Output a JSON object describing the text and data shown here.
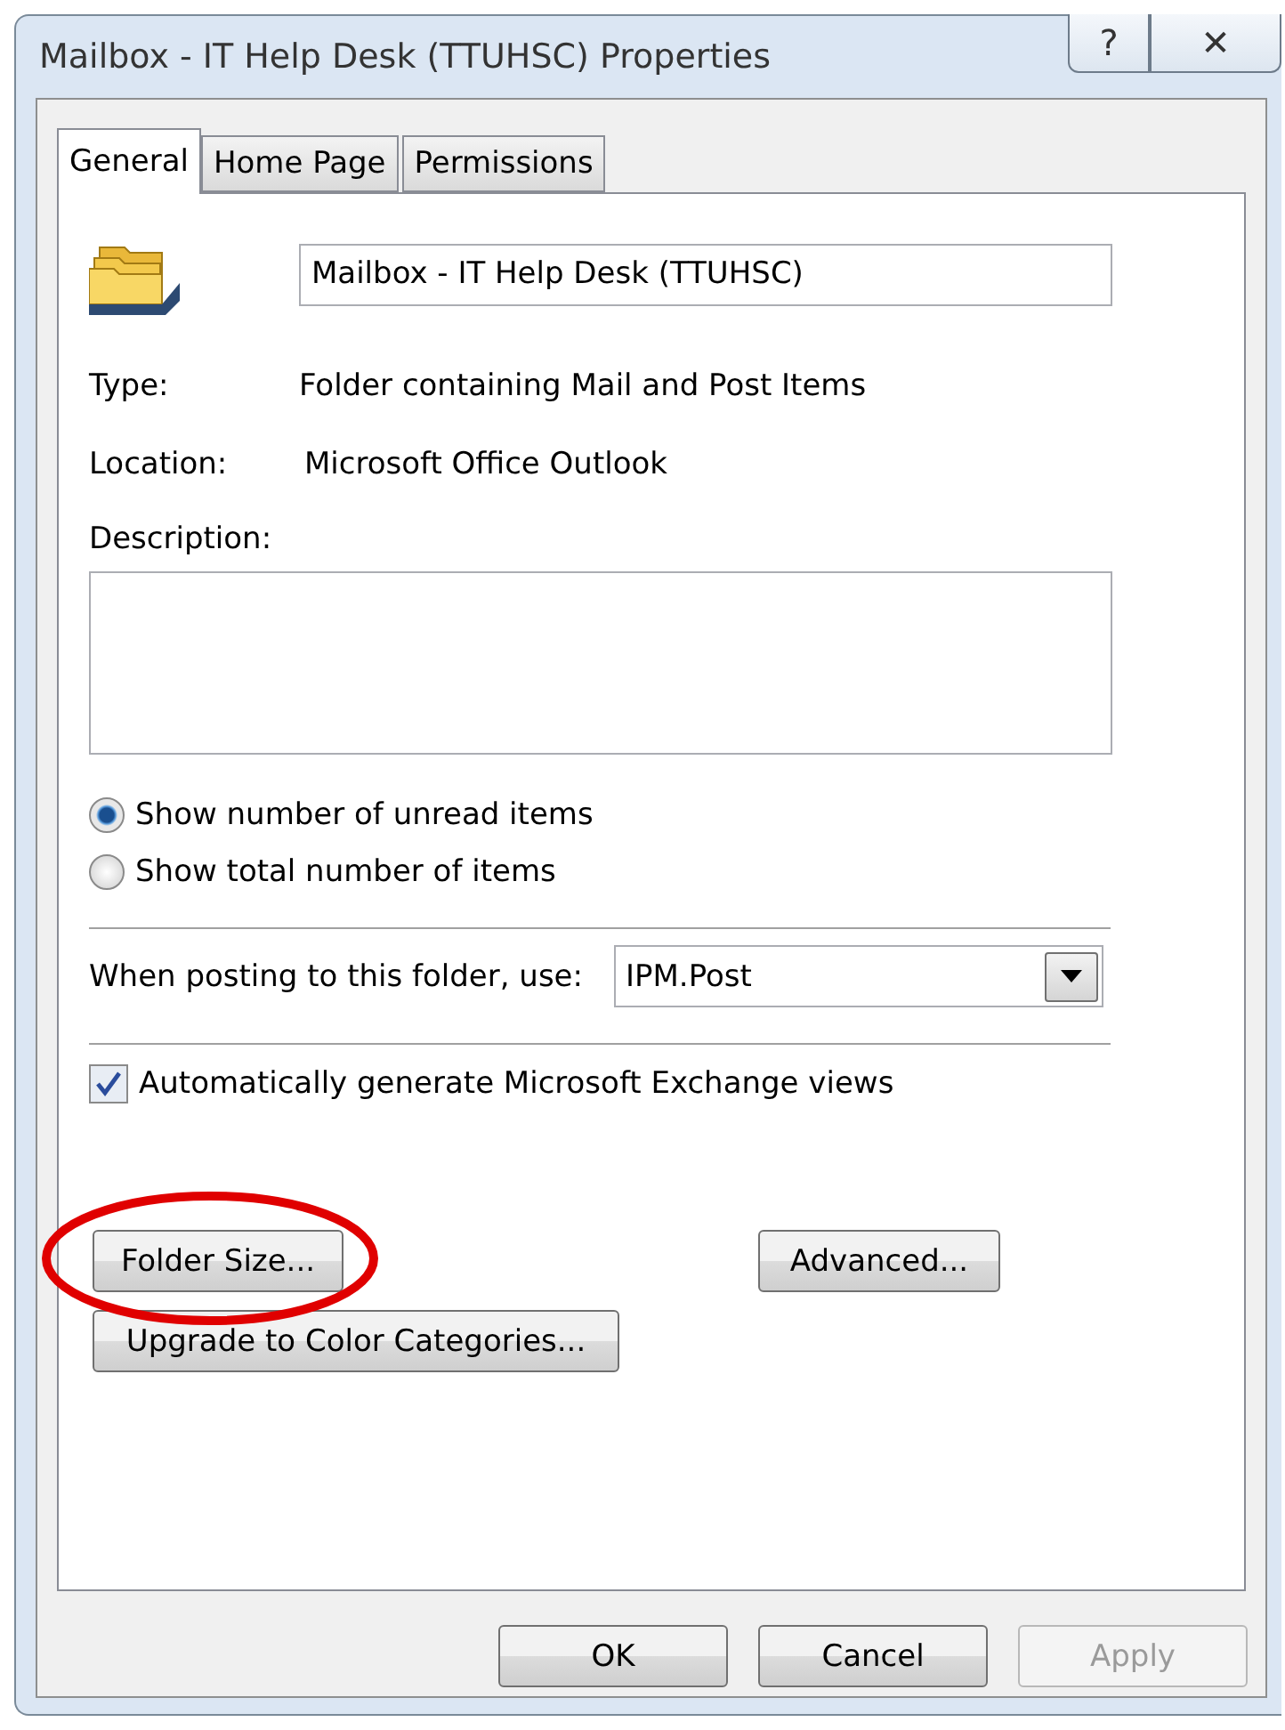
{
  "window": {
    "title": "Mailbox - IT Help Desk (TTUHSC) Properties",
    "title_buttons": [
      "?",
      "✕"
    ]
  },
  "tabs": [
    {
      "label": "General",
      "selected": true
    },
    {
      "label": "Home Page",
      "selected": false
    },
    {
      "label": "Permissions",
      "selected": false
    }
  ],
  "general": {
    "name_value": "Mailbox - IT Help Desk (TTUHSC)",
    "type": {
      "label": "Type:",
      "value": "Folder containing Mail and Post Items"
    },
    "location": {
      "label": "Location:",
      "value": "Microsoft Office Outlook"
    },
    "description": {
      "label": "Description:"
    },
    "count_options": [
      {
        "label": "Show number of unread items",
        "selected": true
      },
      {
        "label": "Show total number of items",
        "selected": false
      }
    ],
    "posting": {
      "label": "When posting to this folder, use:",
      "value": "IPM.Post"
    },
    "exchange_views": {
      "label": "Automatically generate Microsoft Exchange views",
      "checked": true
    },
    "folder_size_button": {
      "label": "Folder Size...",
      "highlighted": true
    },
    "advanced_button": "Advanced...",
    "upgrade_button": "Upgrade to Color Categories..."
  },
  "buttons": [
    {
      "label": "OK",
      "disabled": false
    },
    {
      "label": "Cancel",
      "disabled": false
    },
    {
      "label": "Apply",
      "disabled": true
    }
  ]
}
